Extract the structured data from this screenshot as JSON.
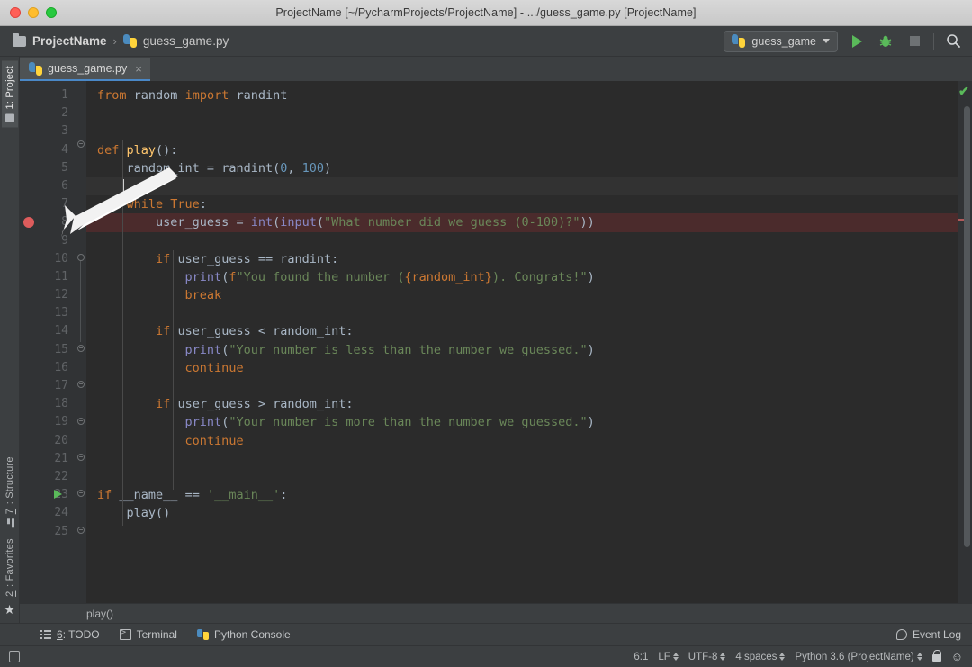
{
  "window": {
    "title": "ProjectName [~/PycharmProjects/ProjectName] - .../guess_game.py [ProjectName]"
  },
  "toolbar": {
    "project_name": "ProjectName",
    "separator": "›",
    "file_name": "guess_game.py",
    "run_config": "guess_game",
    "icons": {
      "folder": "folder-icon",
      "python": "python-file-icon",
      "run": "run-icon",
      "debug": "debug-icon",
      "stop": "stop-icon",
      "search": "search-icon"
    }
  },
  "left_strip": {
    "project_tab": "1: Project",
    "project_tab_key": "1",
    "project_tab_rest": ": Project",
    "structure_tab_key": "7",
    "structure_tab_rest": ": Structure",
    "favorites_tab_key": "2",
    "favorites_tab_rest": ": Favorites",
    "star": "★"
  },
  "tabs": [
    {
      "label": "guess_game.py",
      "close": "×"
    }
  ],
  "editor": {
    "caret_line": 6,
    "breakpoint_line": 8,
    "run_marker_line": 23,
    "inspection_status": "✔",
    "bottom_breadcrumb": "play()",
    "line_numbers": [
      1,
      2,
      3,
      4,
      5,
      6,
      7,
      8,
      9,
      10,
      11,
      12,
      13,
      14,
      15,
      16,
      17,
      18,
      19,
      20,
      21,
      22,
      23,
      24,
      25
    ],
    "code_lines": [
      "from random import randint",
      "",
      "",
      "def play():",
      "    random_int = randint(0, 100)",
      "",
      "    while True:",
      "        user_guess = int(input(\"What number did we guess (0-100)?\"))",
      "",
      "        if user_guess == randint:",
      "            print(f\"You found the number ({random_int}). Congrats!\")",
      "            break",
      "",
      "        if user_guess < random_int:",
      "            print(\"Your number is less than the number we guessed.\")",
      "            continue",
      "",
      "        if user_guess > random_int:",
      "            print(\"Your number is more than the number we guessed.\")",
      "            continue",
      "",
      "",
      "if __name__ == '__main__':",
      "    play()",
      ""
    ]
  },
  "tool_windows": {
    "todo_key": "6",
    "todo_rest": ": TODO",
    "terminal": "Terminal",
    "python_console": "Python Console",
    "event_log": "Event Log"
  },
  "statusbar": {
    "position": "6:1",
    "line_separator": "LF",
    "encoding": "UTF-8",
    "indent": "4 spaces",
    "interpreter": "Python 3.6 (ProjectName)",
    "lock": "lock-icon",
    "hat": "🎩"
  },
  "colors": {
    "editor_bg": "#2b2b2b",
    "gutter_bg": "#313335",
    "chrome_bg": "#3c3f41",
    "keyword": "#cc7832",
    "function": "#ffc66d",
    "number": "#6897bb",
    "string": "#6a8759",
    "builtin": "#8888c6",
    "identifier": "#a9b7c6",
    "accent": "#4a88c7",
    "breakpoint": "#dd5c5c",
    "run_green": "#5aba5a"
  }
}
